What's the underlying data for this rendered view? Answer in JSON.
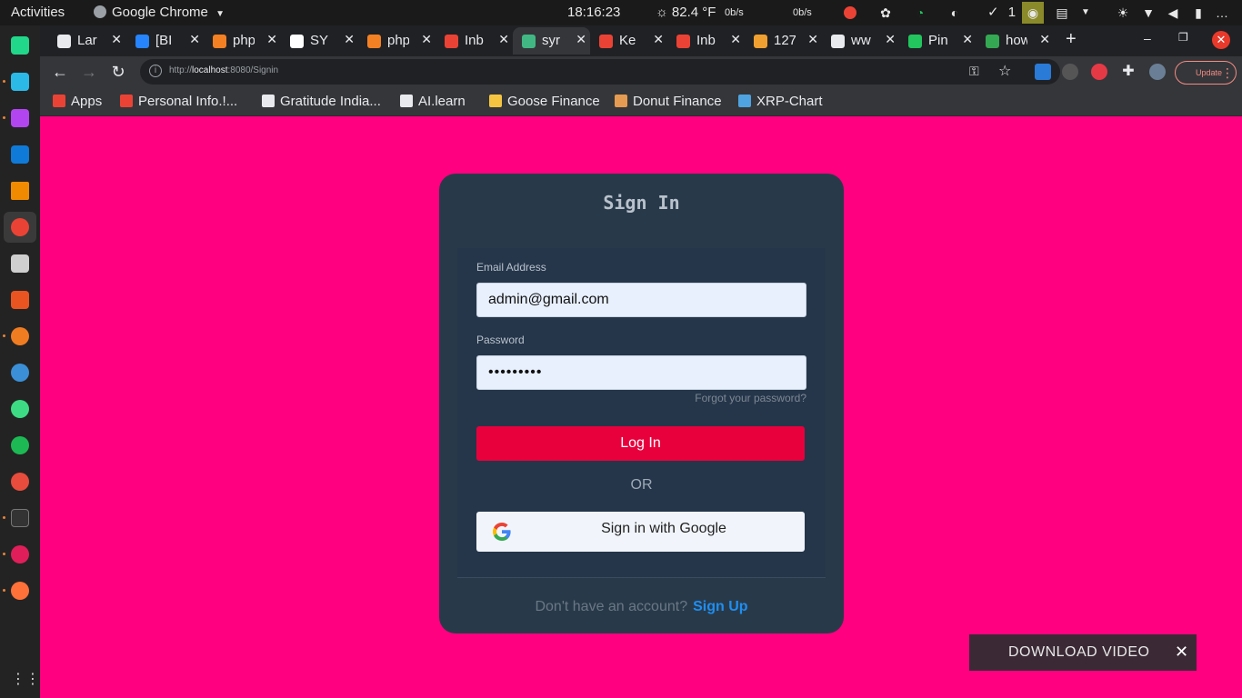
{
  "system_bar": {
    "activities": "Activities",
    "app_name": "Google Chrome",
    "clock": "18:16:23",
    "weather": "82.4 °F",
    "net_up": "0b/s",
    "net_down": "0b/s",
    "tasks_count": "1"
  },
  "tabs": [
    {
      "title": "Lar",
      "favicon": "globe-icon",
      "color": "#e8eaed"
    },
    {
      "title": "[BI",
      "favicon": "jira-icon",
      "color": "#2684ff"
    },
    {
      "title": "php",
      "favicon": "stackoverflow-icon",
      "color": "#f48024"
    },
    {
      "title": "SY",
      "favicon": "notion-icon",
      "color": "#ffffff"
    },
    {
      "title": "php",
      "favicon": "stackoverflow-icon",
      "color": "#f48024"
    },
    {
      "title": "Inb",
      "favicon": "gmail-icon",
      "color": "#ea4335"
    },
    {
      "title": "syr",
      "favicon": "vue-icon",
      "color": "#41b883",
      "active": true
    },
    {
      "title": "Ke",
      "favicon": "gmail-icon",
      "color": "#ea4335"
    },
    {
      "title": "Inb",
      "favicon": "gmail-icon",
      "color": "#ea4335"
    },
    {
      "title": "127",
      "favicon": "pma-icon",
      "color": "#f0a030"
    },
    {
      "title": "ww",
      "favicon": "chat-icon",
      "color": "#e8eaed"
    },
    {
      "title": "Pin",
      "favicon": "pinned-icon",
      "color": "#22c55e"
    },
    {
      "title": "how",
      "favicon": "sparkle-icon",
      "color": "#34a853"
    }
  ],
  "toolbar": {
    "url_prefix": "http://",
    "url_host": "localhost",
    "url_rest": ":8080/Signin",
    "update_label": "Update"
  },
  "bookmarks": [
    {
      "label": "Apps",
      "icon": "apps-grid-icon",
      "color": "#ea4335"
    },
    {
      "label": "Personal Info.!...",
      "icon": "gmail-icon",
      "color": "#ea4335"
    },
    {
      "label": "Gratitude India...",
      "icon": "check-circle-icon",
      "color": "#e8eaed"
    },
    {
      "label": "AI.learn",
      "icon": "github-icon",
      "color": "#e8eaed"
    },
    {
      "label": "Goose Finance",
      "icon": "goose-icon",
      "color": "#f5c542"
    },
    {
      "label": "Donut Finance",
      "icon": "donut-icon",
      "color": "#e59b52"
    },
    {
      "label": "XRP-Chart",
      "icon": "chart-icon",
      "color": "#4fa3e0"
    }
  ],
  "signin": {
    "title": "Sign In",
    "email_label": "Email Address",
    "email_value": "admin@gmail.com",
    "password_label": "Password",
    "password_value": "•••••••••",
    "forgot_link": "Forgot your password?",
    "login_button": "Log In",
    "or_text": "OR",
    "google_button": "Sign in with Google",
    "no_account": "Don't have an account?",
    "signup_link": "Sign Up"
  },
  "download_bar": {
    "label": "DOWNLOAD VIDEO"
  },
  "colors": {
    "page_bg": "#ff0080",
    "card_bg": "#283a4a",
    "login_button": "#e8003d",
    "signup_link": "#1f8ef1"
  }
}
